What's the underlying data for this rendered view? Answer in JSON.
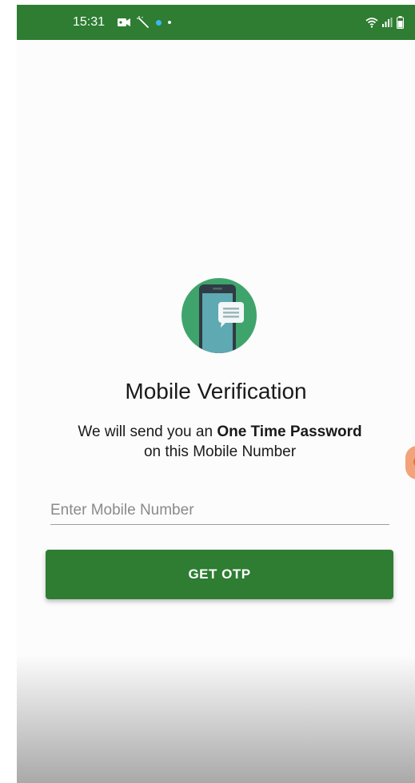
{
  "status_bar": {
    "time": "15:31",
    "left_icons": [
      "video-camera-icon",
      "magic-wand-icon",
      "blue-dot-icon",
      "dot-icon"
    ],
    "right_icons": [
      "wifi-icon",
      "signal-icon",
      "battery-icon"
    ]
  },
  "logo": {
    "icon": "phone-message-icon"
  },
  "page": {
    "title": "Mobile Verification",
    "subtitle_prefix": "We will send you an ",
    "subtitle_bold": "One Time Password",
    "subtitle_suffix": "on this Mobile Number"
  },
  "form": {
    "mobile_placeholder": "Enter Mobile Number",
    "mobile_value": "",
    "submit_label": "GET OTP"
  },
  "colors": {
    "primary": "#2e7d32",
    "logo_bg": "#3fa46b",
    "phone_screen": "#5fa9b2",
    "message_bubble": "#f2f7f8",
    "edge_bubble": "#f2a379"
  }
}
